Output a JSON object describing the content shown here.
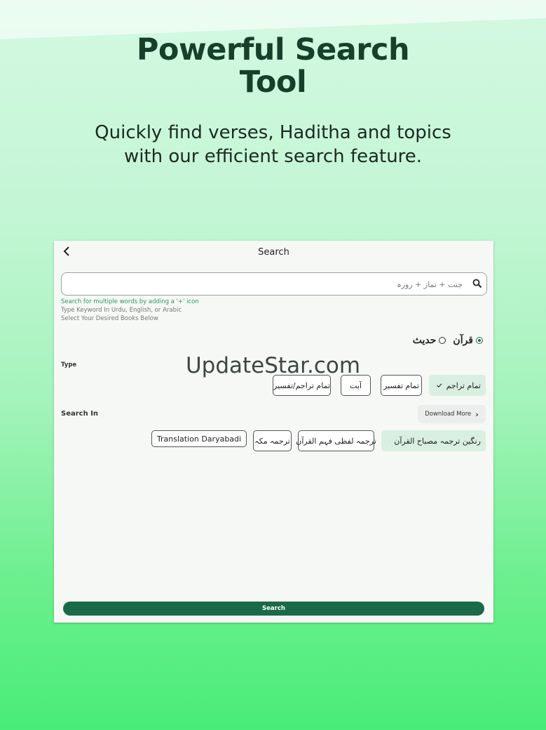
{
  "headline": {
    "line1": "Powerful Search",
    "line2": "Tool"
  },
  "subhead": {
    "line1": "Quickly find verses, Haditha and topics",
    "line2": "with our efficient search feature."
  },
  "screen": {
    "title": "Search",
    "search": {
      "placeholder": "جنت + نماز + روزہ"
    },
    "hints": [
      "Search for multiple words by adding a '+' icon",
      "Type Keyword In Urdu, English, or Arabic",
      "Select Your Desired Books Below"
    ],
    "source_options": [
      {
        "label": "قرآن",
        "selected": true
      },
      {
        "label": "حدیث",
        "selected": false
      }
    ],
    "type_label": "Type",
    "type_chips": [
      {
        "label": "تمام تراجم",
        "selected": true
      },
      {
        "label": "تمام تفسیر",
        "selected": false
      },
      {
        "label": "آیت",
        "selected": false
      },
      {
        "label": "تمام تراجم/تفسیر",
        "selected": false
      }
    ],
    "search_in_label": "Search In",
    "download_more": "Download More",
    "book_chips": [
      {
        "label": "رنگین ترجمہ مصباح القرآن",
        "selected": true
      },
      {
        "label": "ترجمہ لفظی فہم القرآن",
        "selected": false
      },
      {
        "label": "ترجمہ مکہ",
        "selected": false
      },
      {
        "label": "Translation Daryabadi",
        "selected": false
      }
    ],
    "search_button": "Search",
    "accent_color": "#1a6a4a",
    "selected_chip_color": "#d9efe2"
  },
  "watermark": "UpdateStar.com"
}
